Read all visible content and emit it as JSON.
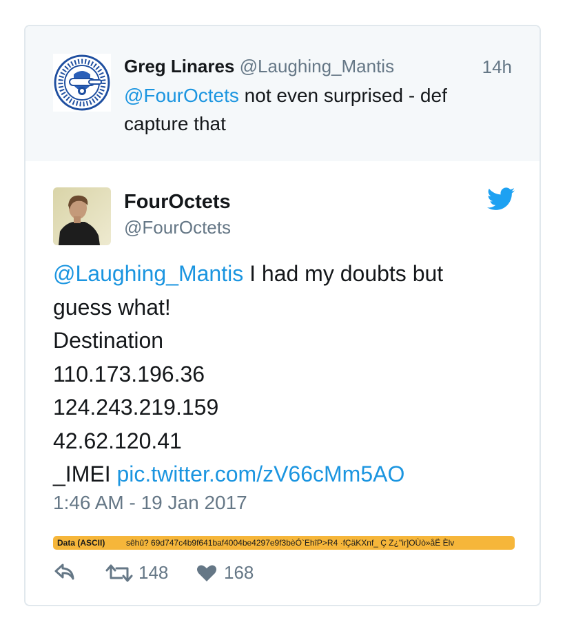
{
  "reply_tweet": {
    "name": "Greg Linares",
    "handle": "@Laughing_Mantis",
    "time": "14h",
    "mention": "@FourOctets",
    "text": " not even surprised - def capture that"
  },
  "tweet": {
    "name": "FourOctets",
    "handle": "@FourOctets",
    "mention": "@Laughing_Mantis",
    "text_line1": " I had my doubts but",
    "lines": [
      "guess what!",
      "Destination",
      "110.173.196.36",
      "124.243.219.159",
      "42.62.120.41"
    ],
    "imei_prefix": "_IMEI ",
    "pic_link": "pic.twitter.com/zV66cMm5AO",
    "timestamp": "1:46 AM - 19 Jan 2017"
  },
  "data_bar": {
    "label": "Data (ASCII)",
    "value": "sêhû? 69d747c4b9f641baf4004be4297e9f3bèÓ`EhîP>R4 ·fÇäKXnf_ Ç Z¿\"ir]OÙò»åË Èlv"
  },
  "actions": {
    "retweets": "148",
    "likes": "168"
  },
  "colors": {
    "link": "#1b95e0",
    "muted": "#657786",
    "reply_bg": "#f5f8fa",
    "data_bar": "#f6b63a",
    "twitter_blue": "#1da1f2"
  },
  "icons": [
    "emblem-avatar",
    "profile-avatar",
    "twitter-bird-icon",
    "reply-icon",
    "retweet-icon",
    "heart-icon"
  ]
}
